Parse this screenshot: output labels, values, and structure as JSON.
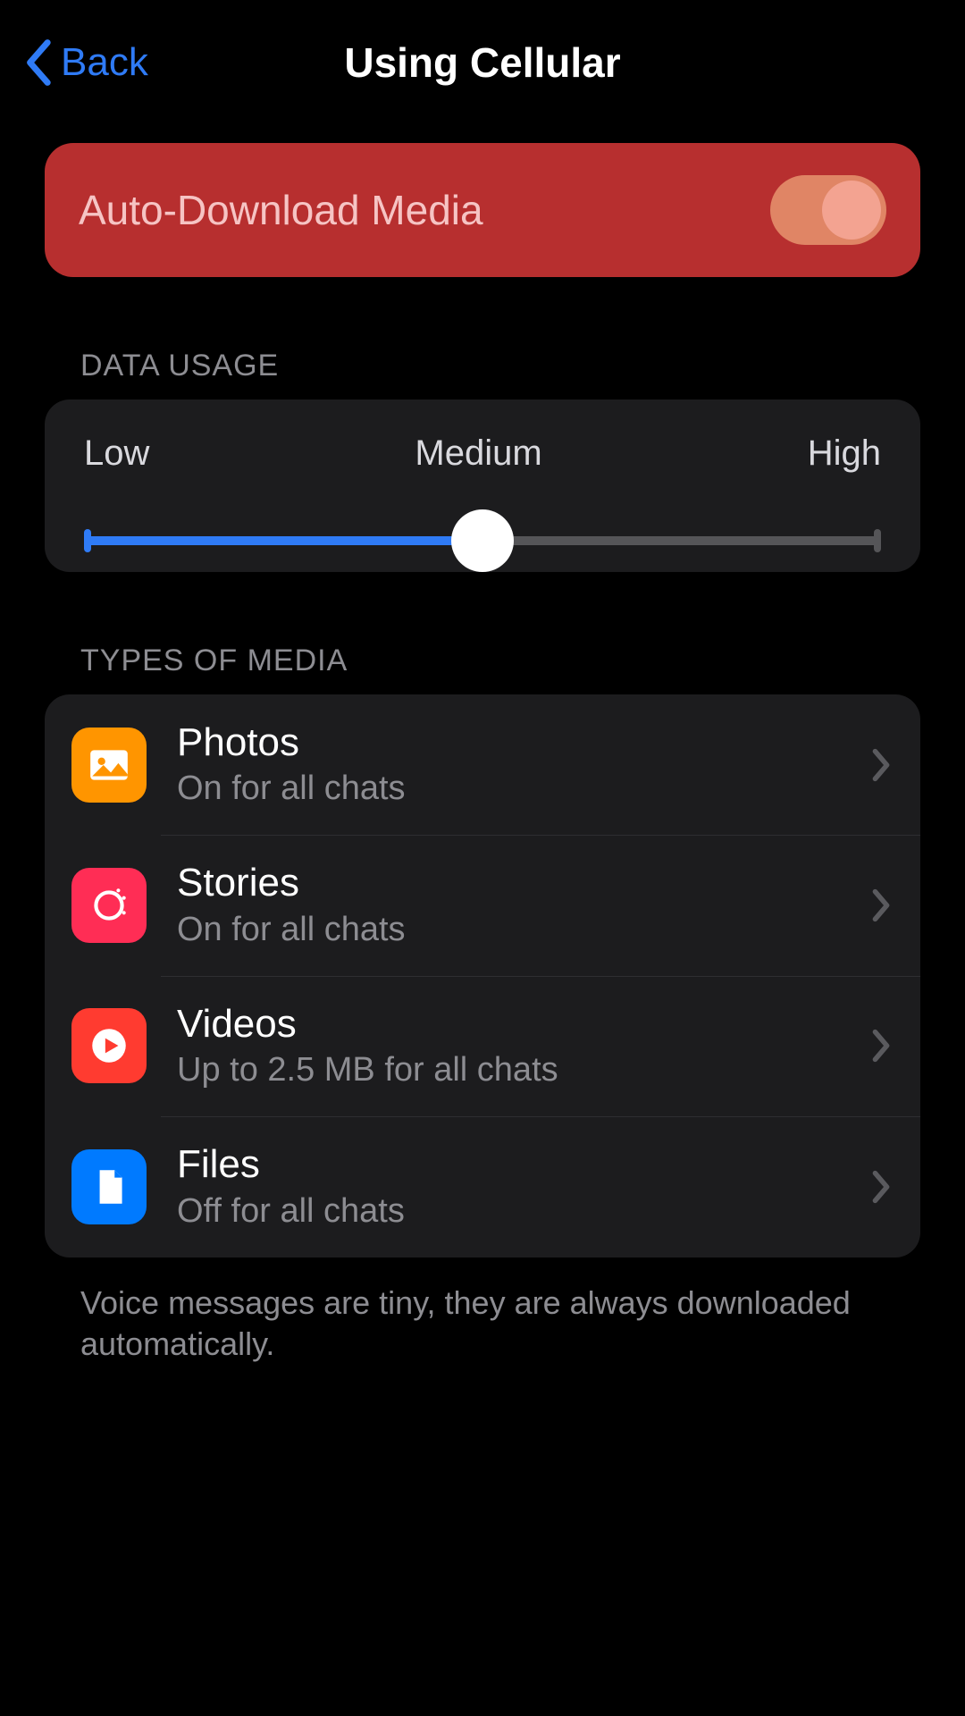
{
  "nav": {
    "back": "Back",
    "title": "Using Cellular"
  },
  "auto_download": {
    "label": "Auto-Download Media",
    "enabled": true
  },
  "data_usage": {
    "header": "DATA USAGE",
    "labels": {
      "low": "Low",
      "medium": "Medium",
      "high": "High"
    },
    "value": "Medium",
    "position_pct": 50
  },
  "media": {
    "header": "TYPES OF MEDIA",
    "items": [
      {
        "icon": "photos-icon",
        "title": "Photos",
        "subtitle": "On for all chats"
      },
      {
        "icon": "stories-icon",
        "title": "Stories",
        "subtitle": "On for all chats"
      },
      {
        "icon": "videos-icon",
        "title": "Videos",
        "subtitle": "Up to 2.5 MB for all chats"
      },
      {
        "icon": "files-icon",
        "title": "Files",
        "subtitle": "Off for all chats"
      }
    ]
  },
  "footer": "Voice messages are tiny, they are always downloaded automatically."
}
